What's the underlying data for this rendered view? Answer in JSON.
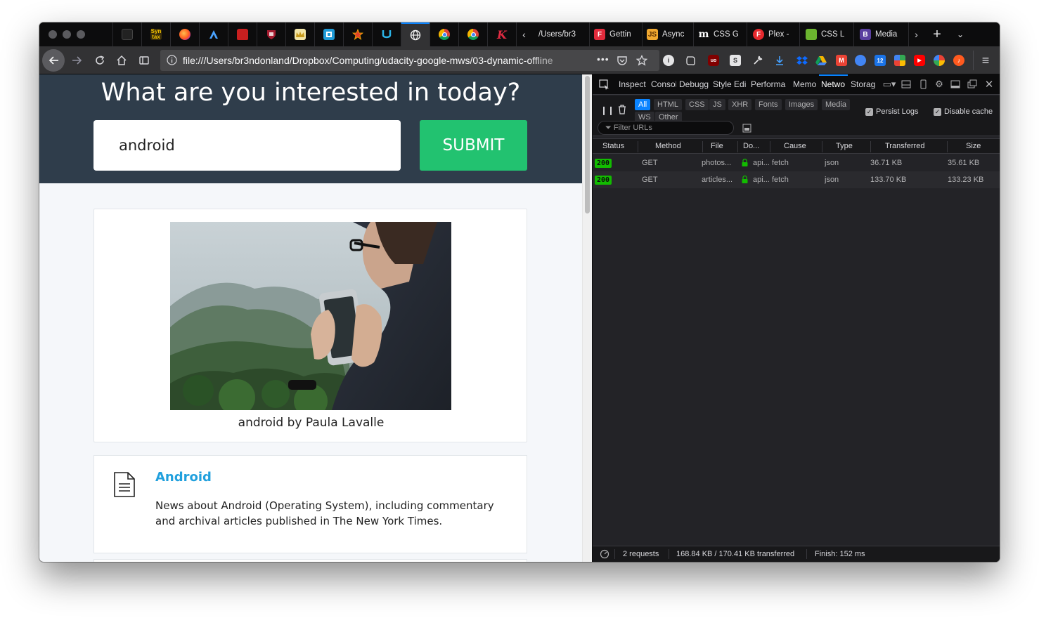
{
  "tabs": [
    {
      "icon": "github-icon",
      "label": ""
    },
    {
      "icon": "syntax-icon",
      "label": "Syn tax"
    },
    {
      "icon": "firefox-icon",
      "label": ""
    },
    {
      "icon": "arc-icon",
      "label": ""
    },
    {
      "icon": "red-jar-icon",
      "label": ""
    },
    {
      "icon": "shield-icon",
      "label": ""
    },
    {
      "icon": "crown-icon",
      "label": ""
    },
    {
      "icon": "box-icon",
      "label": ""
    },
    {
      "icon": "star-icon",
      "label": ""
    },
    {
      "icon": "u-icon",
      "label": ""
    },
    {
      "icon": "globe-icon",
      "label": ""
    },
    {
      "icon": "chrome-icon",
      "label": ""
    },
    {
      "icon": "chrome-icon",
      "label": ""
    },
    {
      "icon": "k-icon",
      "label": ""
    }
  ],
  "tab_labels": {
    "t1": "/Users/br3",
    "t2": "Gettin",
    "t3": "Async",
    "t4": "CSS G",
    "t5": "Plex -",
    "t6": "CSS L",
    "t7": "Media",
    "fav3": "JS",
    "fav4": "m",
    "fav5": "F",
    "fav7": "B"
  },
  "navbar": {
    "url": "file:///Users/br3ndonland/Dropbox/Computing/udacity-google-mws/03-dynamic-offline",
    "more": "•••"
  },
  "page": {
    "heading": "What are you interested in today?",
    "search_value": "android",
    "submit_label": "SUBMIT",
    "photo_caption": "android by Paula Lavalle",
    "article_title": "Android",
    "article_desc": "News about Android (Operating System), including commentary and archival articles published in The New York Times."
  },
  "devtools": {
    "tabs": [
      "Inspect",
      "Consol",
      "Debugg",
      "Style Edi",
      "Performa",
      "Memo",
      "Netwo",
      "Storag"
    ],
    "active_tab": "Netwo",
    "filter_types": [
      "All",
      "HTML",
      "CSS",
      "JS",
      "XHR",
      "Fonts",
      "Images",
      "Media",
      "WS",
      "Other"
    ],
    "active_filter": "All",
    "persist_logs": "Persist Logs",
    "disable_cache": "Disable cache",
    "filter_placeholder": "Filter URLs",
    "columns": {
      "status": "Status",
      "method": "Method",
      "file": "File",
      "domain": "Do...",
      "cause": "Cause",
      "type": "Type",
      "transferred": "Transferred",
      "size": "Size"
    },
    "requests": [
      {
        "status": "200",
        "method": "GET",
        "file": "photos...",
        "domain": "api...",
        "cause": "fetch",
        "type": "json",
        "transferred": "36.71 KB",
        "size": "35.61 KB"
      },
      {
        "status": "200",
        "method": "GET",
        "file": "articles...",
        "domain": "api...",
        "cause": "fetch",
        "type": "json",
        "transferred": "133.70 KB",
        "size": "133.23 KB"
      }
    ],
    "footer": {
      "requests": "2 requests",
      "transferred": "168.84 KB / 170.41 KB transferred",
      "finish": "Finish: 152 ms"
    }
  },
  "colors": {
    "accent": "#0a84ff",
    "submit": "#22c270",
    "hero": "#2f3d4b",
    "status_ok": "#12bc00",
    "link": "#21a0dd"
  }
}
